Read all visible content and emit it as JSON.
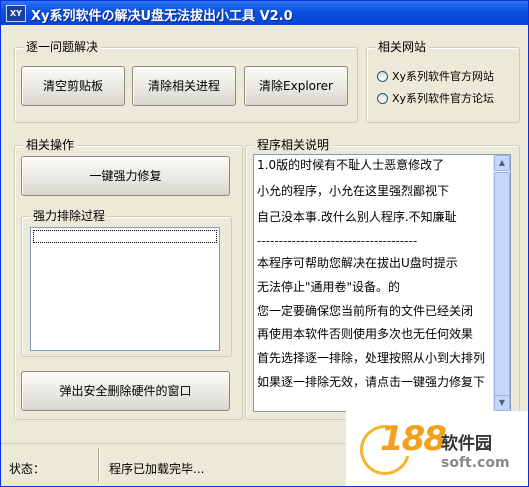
{
  "window": {
    "title": "Xy系列软件の解决U盘无法拔出小工具 V2.0",
    "icon_text": "XY"
  },
  "quick_fix": {
    "label": "逐一问题解决",
    "buttons": [
      "清空剪贴板",
      "清除相关进程",
      "清除Explorer"
    ]
  },
  "sites": {
    "label": "相关网站",
    "options": [
      "Xy系列软件官方网站",
      "Xy系列软件官方论坛"
    ]
  },
  "operations": {
    "label": "相关操作",
    "force_repair": "一键强力修复",
    "process_label": "强力排除过程",
    "eject_window": "弹出安全删除硬件的窗口"
  },
  "description": {
    "label": "程序相关说明",
    "lines": [
      "1.0版的时候有不耻人士恶意修改了",
      "小允的程序，小允在这里强烈鄙视下",
      "自己没本事.改什么别人程序.不知廉耻",
      "-------------------------------------",
      "本程序可帮助您解决在拔出U盘时提示",
      "无法停止\"通用卷\"设备。的",
      "您一定要确保您当前所有的文件已经关闭",
      "再使用本软件否则使用多次也无任何效果",
      "首先选择逐一排除，处理按照从小到大排列",
      "如果逐一排除无效，请点击一键强力修复下"
    ]
  },
  "status": {
    "label": "状态：",
    "message": "程序已加载完毕..."
  },
  "watermark": {
    "number": "188",
    "name": "软件园",
    "domain": "soft.com"
  },
  "colors": {
    "titlebar": "#0a50df",
    "face": "#ece9d8",
    "accent": "#f4a01b"
  }
}
